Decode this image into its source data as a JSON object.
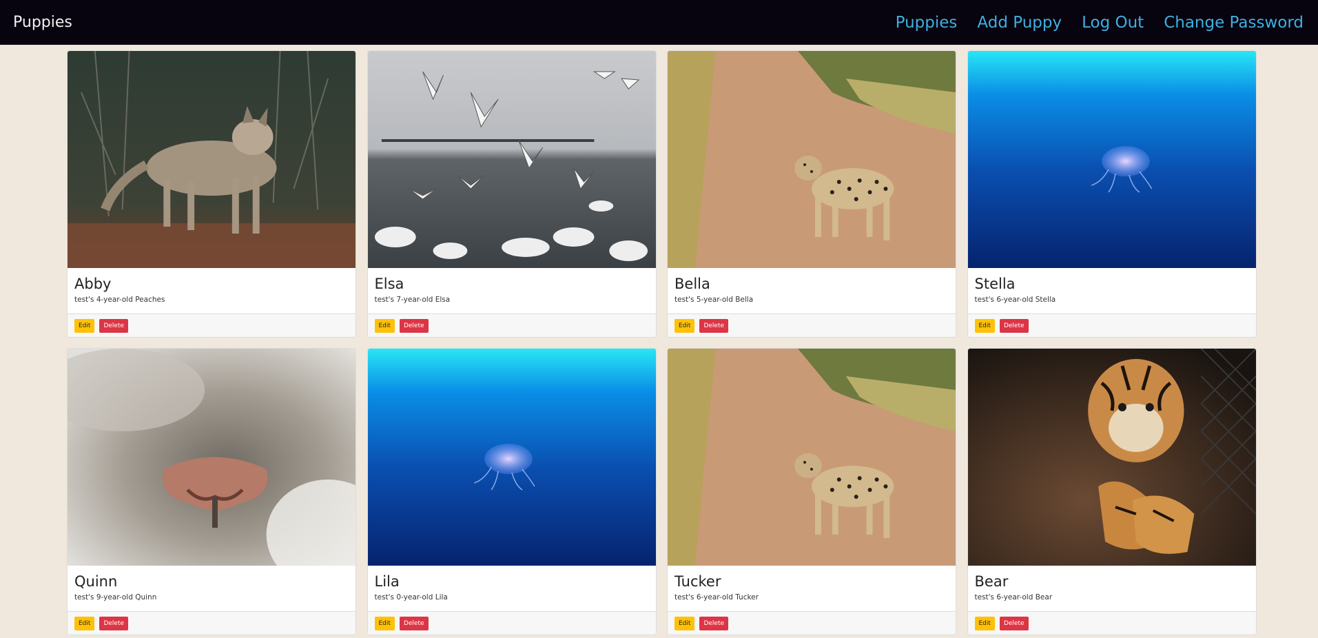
{
  "navbar": {
    "brand": "Puppies",
    "links": [
      "Puppies",
      "Add Puppy",
      "Log Out",
      "Change Password"
    ]
  },
  "cards": [
    {
      "name": "Abby",
      "desc": "test's 4-year-old Peaches",
      "image": "coyote-in-forest",
      "edit": "Edit",
      "delete": "Delete"
    },
    {
      "name": "Elsa",
      "desc": "test's 7-year-old Elsa",
      "image": "seagulls-and-swans",
      "edit": "Edit",
      "delete": "Delete"
    },
    {
      "name": "Bella",
      "desc": "test's 5-year-old Bella",
      "image": "leopard-on-dirt-road",
      "edit": "Edit",
      "delete": "Delete"
    },
    {
      "name": "Stella",
      "desc": "test's 6-year-old Stella",
      "image": "jellyfish-underwater",
      "edit": "Edit",
      "delete": "Delete"
    },
    {
      "name": "Quinn",
      "desc": "test's 9-year-old Quinn",
      "image": "cat-nose-closeup",
      "edit": "Edit",
      "delete": "Delete"
    },
    {
      "name": "Lila",
      "desc": "test's 0-year-old Lila",
      "image": "jellyfish-underwater",
      "edit": "Edit",
      "delete": "Delete"
    },
    {
      "name": "Tucker",
      "desc": "test's 6-year-old Tucker",
      "image": "leopard-on-dirt-road",
      "edit": "Edit",
      "delete": "Delete"
    },
    {
      "name": "Bear",
      "desc": "test's 6-year-old Bear",
      "image": "tiger-cub-lying",
      "edit": "Edit",
      "delete": "Delete"
    }
  ],
  "colors": {
    "navbar_bg": "#07030f",
    "page_bg": "#f0e8dc",
    "link": "#3fb0e0",
    "edit_button": "#ffc107",
    "delete_button": "#dc3545"
  }
}
